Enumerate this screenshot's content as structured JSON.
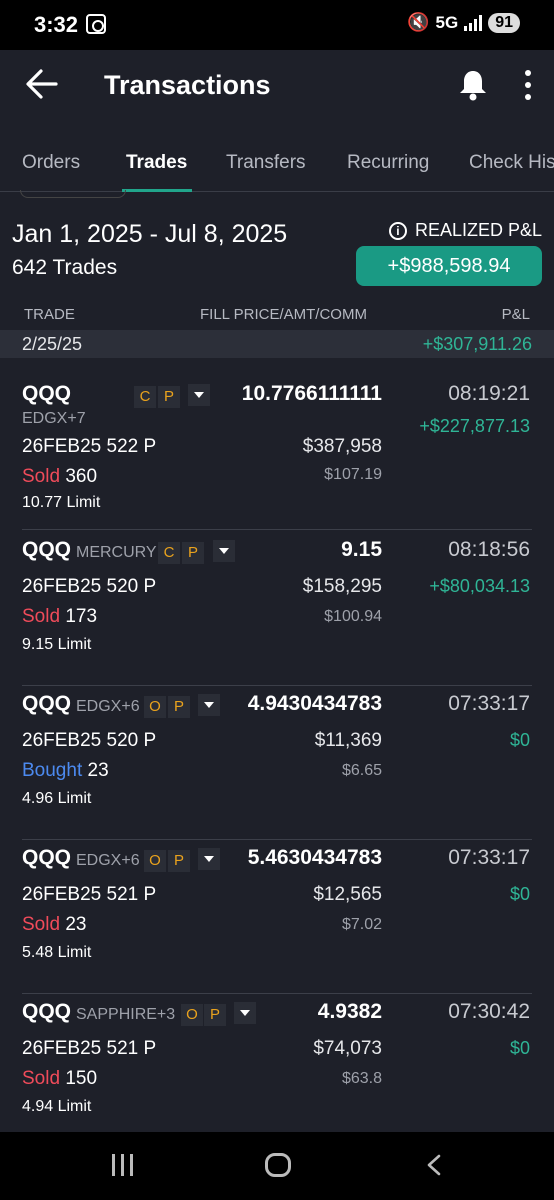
{
  "status": {
    "time": "3:32",
    "network": "5G",
    "battery": "91"
  },
  "header": {
    "title": "Transactions"
  },
  "tabs": [
    "Orders",
    "Trades",
    "Transfers",
    "Recurring",
    "Check His"
  ],
  "active_tab": "Trades",
  "summary": {
    "date_range": "Jan 1, 2025 - Jul 8, 2025",
    "trade_count": "642 Trades",
    "realized_label": "REALIZED P&L",
    "realized_value": "+$988,598.94"
  },
  "columns": {
    "trade": "TRADE",
    "fill": "FILL PRICE/AMT/COMM",
    "pnl": "P&L"
  },
  "date_group": {
    "date": "2/25/25",
    "pnl": "+$307,911.26"
  },
  "trades": [
    {
      "symbol": "QQQ",
      "exchange": "EDGX+7",
      "badge1": "C",
      "badge2": "P",
      "fill_price": "10.7766111111",
      "time": "08:19:21",
      "contract": "26FEB25 522 P",
      "amount": "$387,958",
      "pnl": "+$227,877.13",
      "action": "Sold",
      "quantity": "360",
      "commission": "$107.19",
      "limit": "10.77 Limit"
    },
    {
      "symbol": "QQQ",
      "exchange": "MERCURY",
      "badge1": "C",
      "badge2": "P",
      "fill_price": "9.15",
      "time": "08:18:56",
      "contract": "26FEB25 520 P",
      "amount": "$158,295",
      "pnl": "+$80,034.13",
      "action": "Sold",
      "quantity": "173",
      "commission": "$100.94",
      "limit": "9.15 Limit"
    },
    {
      "symbol": "QQQ",
      "exchange": "EDGX+6",
      "badge1": "O",
      "badge2": "P",
      "fill_price": "4.9430434783",
      "time": "07:33:17",
      "contract": "26FEB25 520 P",
      "amount": "$11,369",
      "pnl": "$0",
      "action": "Bought",
      "quantity": "23",
      "commission": "$6.65",
      "limit": "4.96 Limit"
    },
    {
      "symbol": "QQQ",
      "exchange": "EDGX+6",
      "badge1": "O",
      "badge2": "P",
      "fill_price": "5.4630434783",
      "time": "07:33:17",
      "contract": "26FEB25 521 P",
      "amount": "$12,565",
      "pnl": "$0",
      "action": "Sold",
      "quantity": "23",
      "commission": "$7.02",
      "limit": "5.48 Limit"
    },
    {
      "symbol": "QQQ",
      "exchange": "SAPPHIRE+3",
      "badge1": "O",
      "badge2": "P",
      "fill_price": "4.9382",
      "time": "07:30:42",
      "contract": "26FEB25 521 P",
      "amount": "$74,073",
      "pnl": "$0",
      "action": "Sold",
      "quantity": "150",
      "commission": "$63.8",
      "limit": "4.94 Limit"
    }
  ]
}
